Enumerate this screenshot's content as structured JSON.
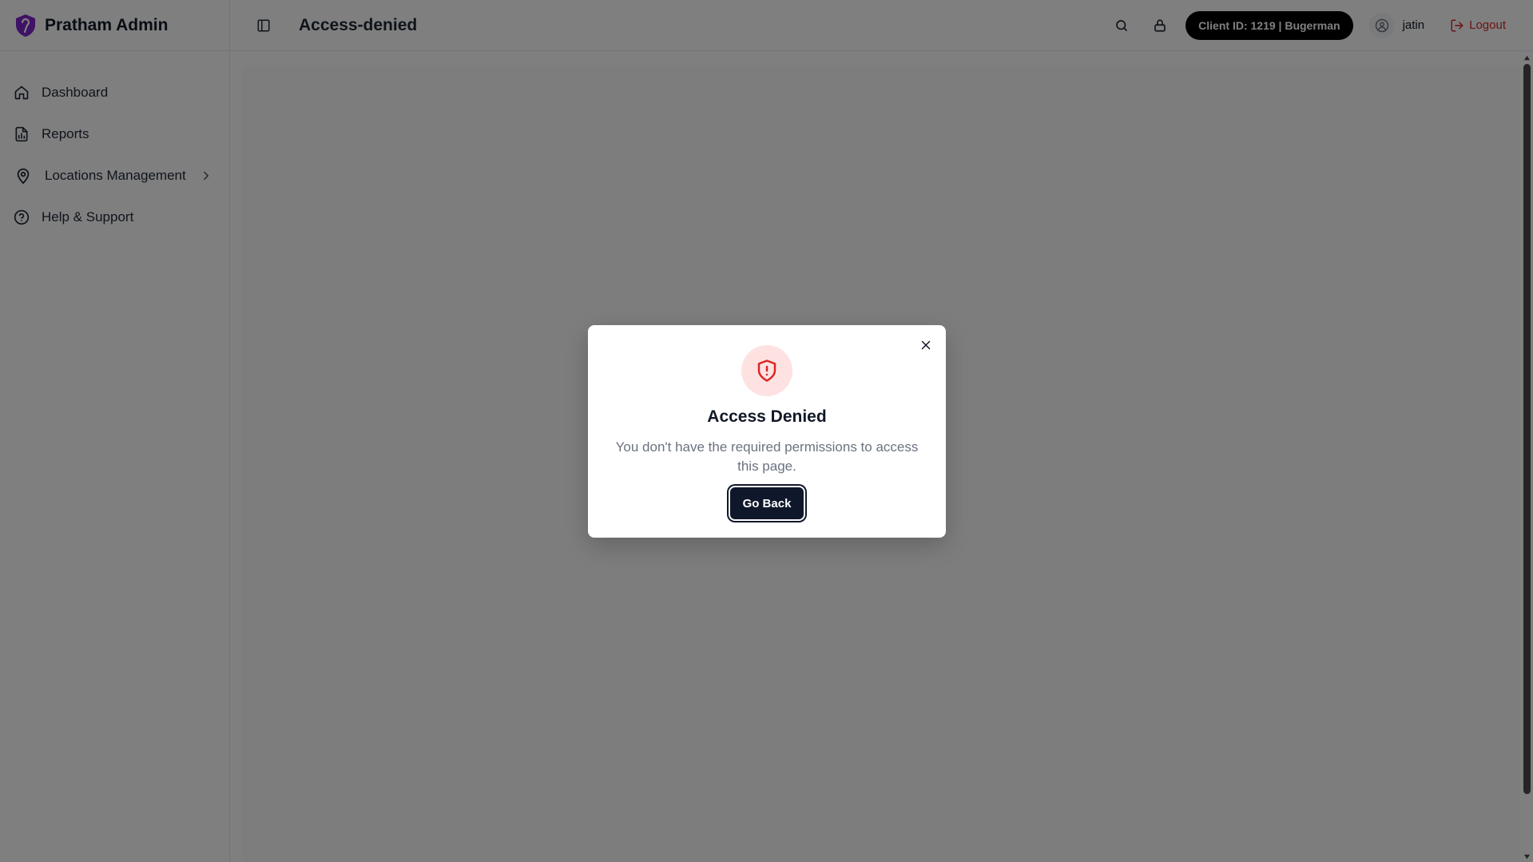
{
  "brand": {
    "name": "Pratham Admin",
    "logo_icon": "shield-logo-icon",
    "logo_color": "#7e22ce"
  },
  "sidebar": {
    "items": [
      {
        "label": "Dashboard",
        "icon": "home-icon"
      },
      {
        "label": "Reports",
        "icon": "report-file-icon"
      },
      {
        "label": "Locations Management",
        "icon": "map-pin-icon",
        "has_submenu": true
      },
      {
        "label": "Help & Support",
        "icon": "help-circle-icon"
      }
    ]
  },
  "header": {
    "page_title": "Access-denied",
    "client_pill": "Client ID: 1219 | Bugerman",
    "user_name": "jatin",
    "logout_label": "Logout"
  },
  "modal": {
    "title": "Access Denied",
    "message": "You don't have the required permissions to access this page.",
    "button_label": "Go Back",
    "icon": "shield-alert-icon"
  },
  "colors": {
    "accent_dark": "#0f172a",
    "danger": "#dc2626",
    "danger_soft": "#fee2e2",
    "overlay": "rgba(0,0,0,0.5)"
  }
}
